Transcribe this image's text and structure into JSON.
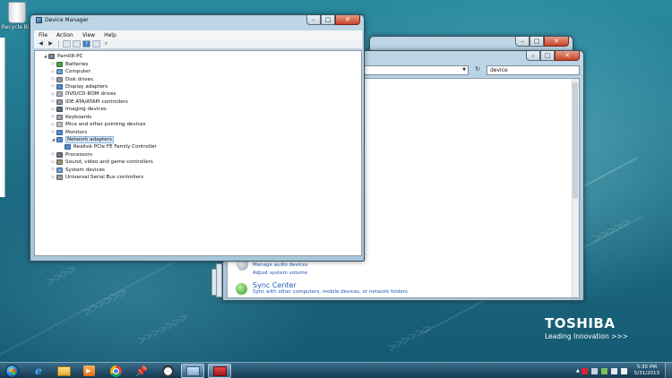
{
  "desktop": {
    "recycle_bin_label": "Recycle Bin",
    "brand_name": "TOSHIBA",
    "brand_tagline": "Leading Innovation >>>"
  },
  "device_manager": {
    "title": "Device Manager",
    "menu": [
      "File",
      "Action",
      "View",
      "Help"
    ],
    "tree": [
      {
        "label": "Pam08-PC",
        "level": 0,
        "expander": "down",
        "color": "#7a8794"
      },
      {
        "label": "Batteries",
        "level": 1,
        "expander": "right",
        "color": "#4aa44a"
      },
      {
        "label": "Computer",
        "level": 1,
        "expander": "right",
        "color": "#6d9ed6"
      },
      {
        "label": "Disk drives",
        "level": 1,
        "expander": "right",
        "color": "#8f9aa5"
      },
      {
        "label": "Display adapters",
        "level": 1,
        "expander": "right",
        "color": "#4f8fd2"
      },
      {
        "label": "DVD/CD-ROM drives",
        "level": 1,
        "expander": "right",
        "color": "#a7b1bb"
      },
      {
        "label": "IDE ATA/ATAPI controllers",
        "level": 1,
        "expander": "right",
        "color": "#8c96a0"
      },
      {
        "label": "Imaging devices",
        "level": 1,
        "expander": "right",
        "color": "#5b6e80"
      },
      {
        "label": "Keyboards",
        "level": 1,
        "expander": "right",
        "color": "#9aa3ac"
      },
      {
        "label": "Mice and other pointing devices",
        "level": 1,
        "expander": "right",
        "color": "#b7bfc7"
      },
      {
        "label": "Monitors",
        "level": 1,
        "expander": "right",
        "color": "#4f8fd2"
      },
      {
        "label": "Network adapters",
        "level": 1,
        "expander": "down",
        "color": "#4f8fd2",
        "selected": true
      },
      {
        "label": "Realtek PCIe FE Family Controller",
        "level": 2,
        "expander": "none",
        "color": "#4f8fd2"
      },
      {
        "label": "Processors",
        "level": 1,
        "expander": "right",
        "color": "#6b7681"
      },
      {
        "label": "Sound, video and game controllers",
        "level": 1,
        "expander": "right",
        "color": "#9a8f7a"
      },
      {
        "label": "System devices",
        "level": 1,
        "expander": "right",
        "color": "#6d9ed6"
      },
      {
        "label": "Universal Serial Bus controllers",
        "level": 1,
        "expander": "right",
        "color": "#8f9aa5"
      }
    ]
  },
  "control_panel": {
    "search_value": "device",
    "links": {
      "manage_audio": "Manage audio devices",
      "adjust_volume": "Adjust system volume",
      "sync_center": "Sync Center",
      "sync_desc": "Sync with other computers, mobile devices, or network folders"
    }
  },
  "taskbar": {
    "clock_time": "5:35 PM",
    "clock_date": "5/31/2013"
  }
}
